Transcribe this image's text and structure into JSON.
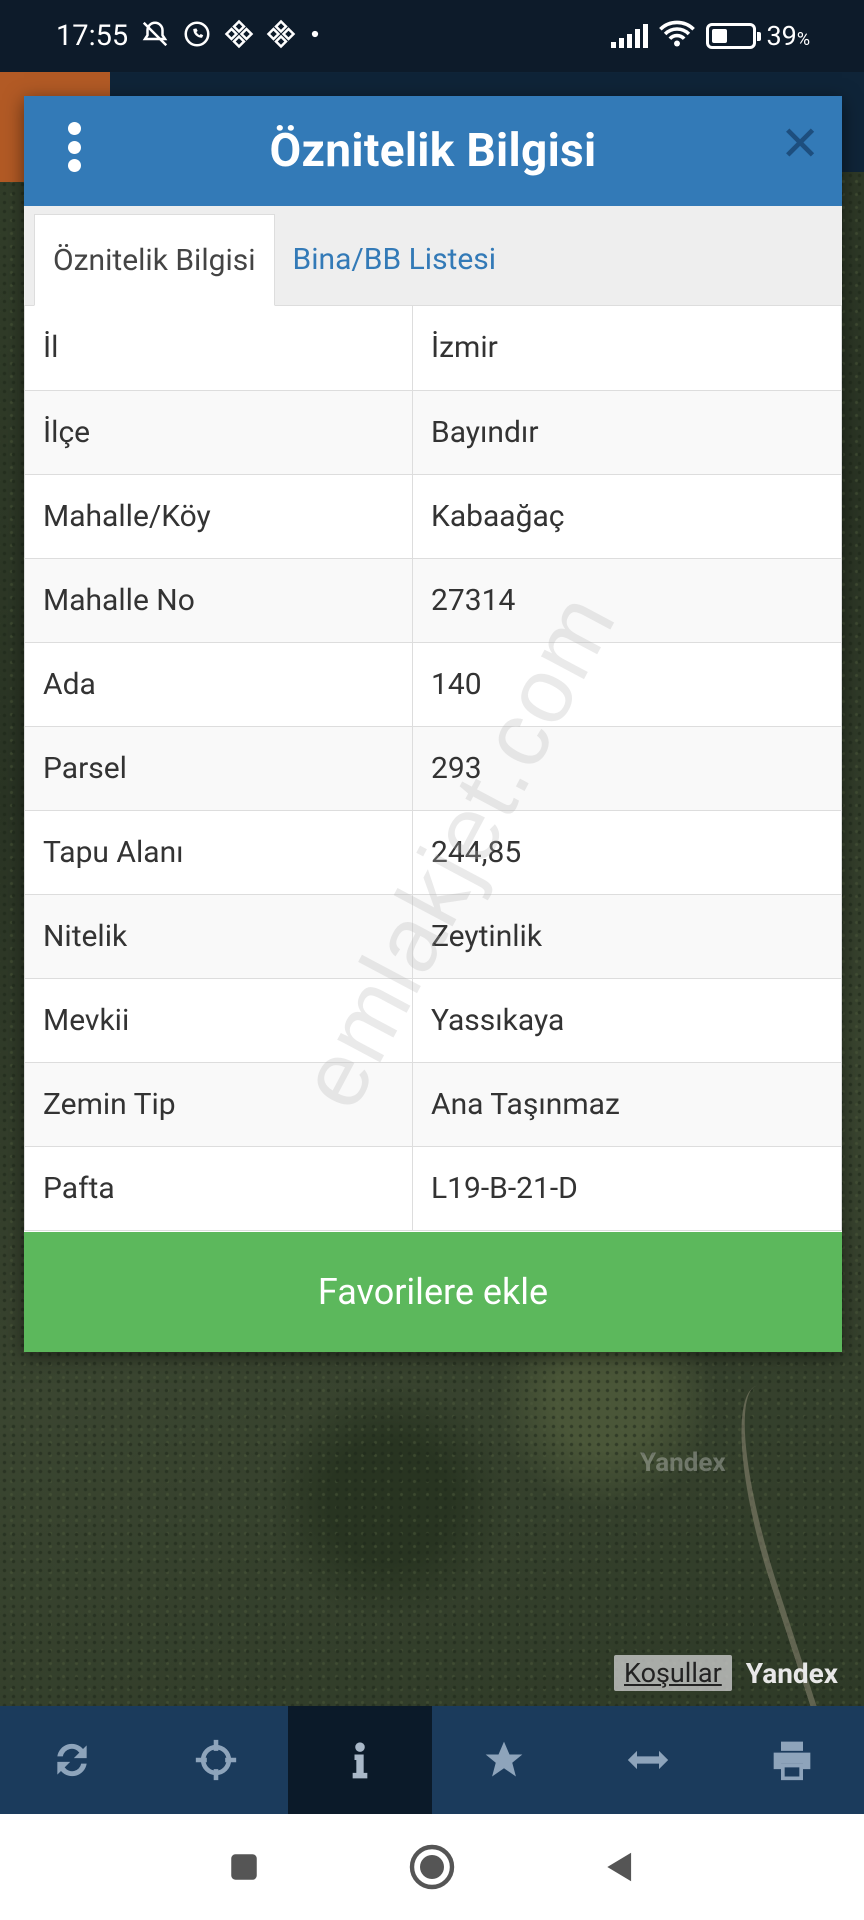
{
  "status_bar": {
    "time": "17:55",
    "battery_level": "39",
    "battery_suffix": "%",
    "icons": [
      "alarm-off-icon",
      "whatsapp-icon",
      "binance-icon",
      "binance-icon",
      "dot-icon",
      "signal-icon",
      "wifi-icon",
      "battery-icon"
    ]
  },
  "dialog": {
    "title": "Öznitelik Bilgisi",
    "tabs": [
      {
        "label": "Öznitelik Bilgisi",
        "active": true
      },
      {
        "label": "Bina/BB Listesi",
        "active": false
      }
    ],
    "rows": [
      {
        "key": "İl",
        "value": "İzmir"
      },
      {
        "key": "İlçe",
        "value": "Bayındır"
      },
      {
        "key": "Mahalle/Köy",
        "value": "Kabaağaç"
      },
      {
        "key": "Mahalle No",
        "value": "27314"
      },
      {
        "key": "Ada",
        "value": "140"
      },
      {
        "key": "Parsel",
        "value": "293"
      },
      {
        "key": "Tapu Alanı",
        "value": "244,85"
      },
      {
        "key": "Nitelik",
        "value": "Zeytinlik"
      },
      {
        "key": "Mevkii",
        "value": "Yassıkaya"
      },
      {
        "key": "Zemin Tip",
        "value": "Ana Taşınmaz"
      },
      {
        "key": "Pafta",
        "value": "L19-B-21-D"
      }
    ],
    "favorite_button": "Favorilere ekle",
    "watermark": "emlakjet.com"
  },
  "map": {
    "map_watermark": "Yandex",
    "terms_link": "Koşullar",
    "provider": "Yandex"
  },
  "toolbar": {
    "items": [
      {
        "icon": "refresh-icon",
        "active": false
      },
      {
        "icon": "locate-icon",
        "active": false
      },
      {
        "icon": "info-icon",
        "active": true
      },
      {
        "icon": "star-icon",
        "active": false
      },
      {
        "icon": "measure-icon",
        "active": false
      },
      {
        "icon": "print-icon",
        "active": false
      }
    ]
  },
  "colors": {
    "header_blue": "#337ab7",
    "success_green": "#5cb85c",
    "toolbar_bg": "#1b3b5c",
    "status_bg": "#0d1b2a"
  }
}
